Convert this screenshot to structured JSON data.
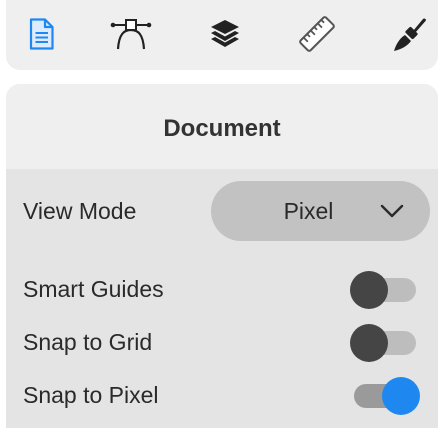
{
  "toolbar": {
    "tools": [
      {
        "name": "document-icon",
        "active": true
      },
      {
        "name": "pen-tool-icon",
        "active": false
      },
      {
        "name": "layers-icon",
        "active": false
      },
      {
        "name": "ruler-icon",
        "active": false
      },
      {
        "name": "paintbrush-icon",
        "active": false
      }
    ]
  },
  "panel": {
    "title": "Document",
    "view_mode": {
      "label": "View Mode",
      "value": "Pixel"
    },
    "toggles": [
      {
        "label": "Smart Guides",
        "on": false
      },
      {
        "label": "Snap to Grid",
        "on": false
      },
      {
        "label": "Snap to Pixel",
        "on": true
      }
    ]
  },
  "colors": {
    "accent": "#1e88f0",
    "knob_off": "#454545",
    "panel_bg": "#e4e4e4",
    "header_bg": "#efefef"
  }
}
